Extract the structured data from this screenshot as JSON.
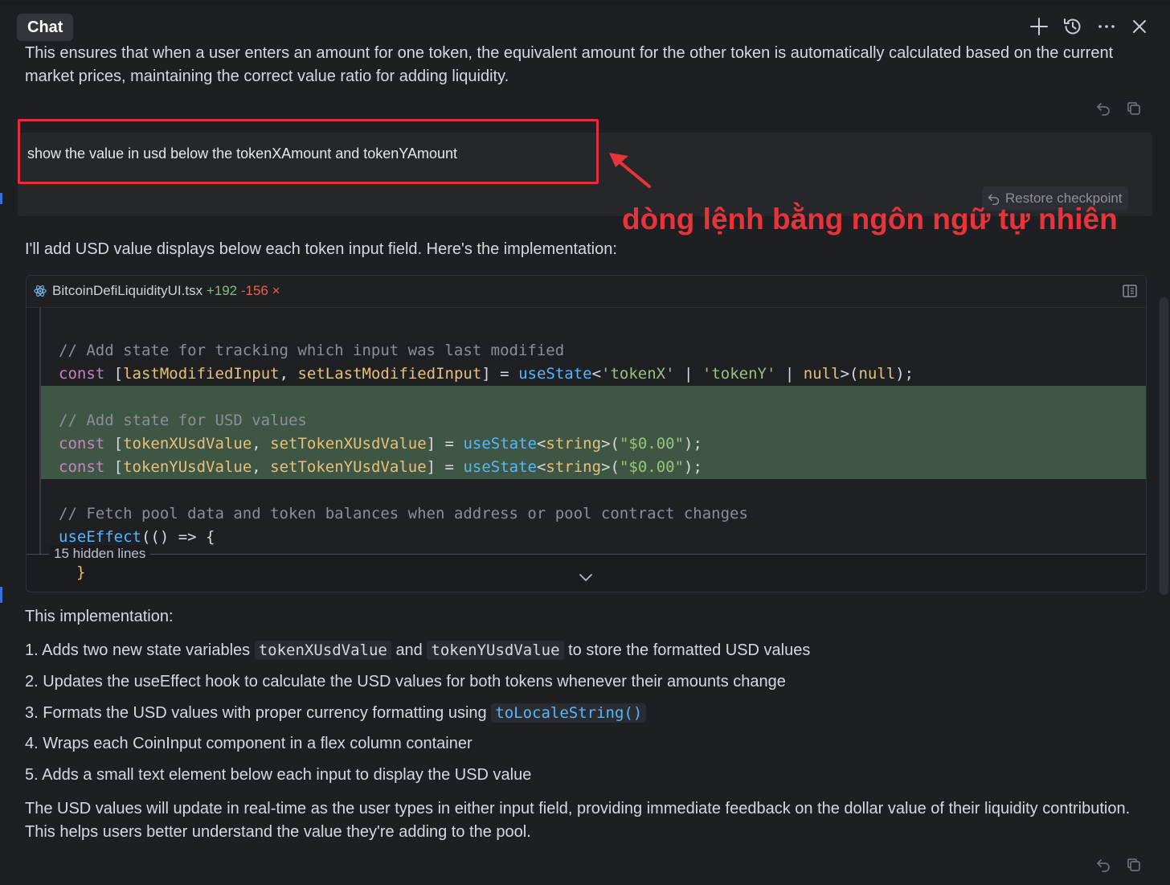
{
  "header": {
    "tab_label": "Chat",
    "icons": [
      "plus-icon",
      "history-icon",
      "more-icon",
      "close-icon"
    ]
  },
  "intro_paragraph": "This ensures that when a user enters an amount for one token, the equivalent amount for the other token is automatically calculated based on the current market prices, maintaining the correct value ratio for adding liquidity.",
  "user_message": "show the value in usd below the tokenXAmount and tokenYAmount",
  "restore_checkpoint_label": "Restore checkpoint",
  "annotation_text": "dòng lệnh bằng ngôn ngữ tự nhiên",
  "response_intro": "I'll add USD value displays below each token input field. Here's the implementation:",
  "code_block": {
    "file_name": "BitcoinDefiLiquidityUI.tsx",
    "additions": "+192",
    "deletions": "-156",
    "remove_mark": "×",
    "hidden_lines_label": "15 hidden lines",
    "closing_brace": "}"
  },
  "implementation_heading": "This implementation:",
  "list": {
    "item1_prefix": "1. Adds two new state variables",
    "item1_code_a": "tokenXUsdValue",
    "item1_mid": "and",
    "item1_code_b": "tokenYUsdValue",
    "item1_suffix": "to store the formatted USD values",
    "item2": "2. Updates the useEffect hook to calculate the USD values for both tokens whenever their amounts change",
    "item3_prefix": "3. Formats the USD values with proper currency formatting using",
    "item3_code": "toLocaleString()",
    "item4": "4. Wraps each CoinInput component in a flex column container",
    "item5": "5. Adds a small text element below each input to display the USD value"
  },
  "closing_paragraph": "The USD values will update in real-time as the user types in either input field, providing immediate feedback on the dollar value of their liquidity contribution. This helps users better understand the value they're adding to the pool.",
  "colors": {
    "background": "#1e1f22",
    "annotation_red": "#e8333a",
    "added_line_bg": "#3f5644",
    "addition_green": "#7fc07a",
    "deletion_red": "#e2664f"
  }
}
